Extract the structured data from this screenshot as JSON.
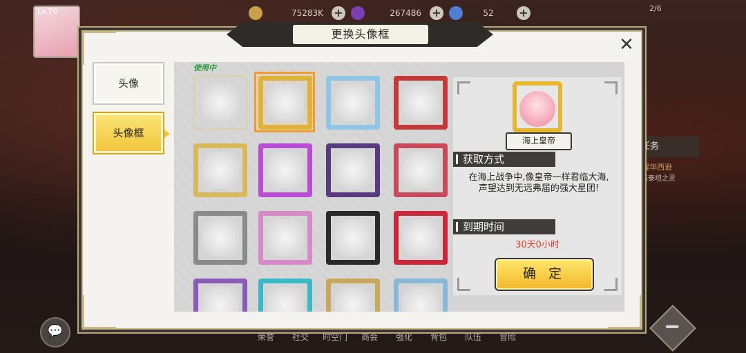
{
  "topbar": {
    "level": "Lv.70",
    "gold": "75283K",
    "gems": "267486",
    "energy": "52",
    "corner_value": "2/6",
    "gold_color": "#c9a14a",
    "gem_color": "#7b3fb0",
    "energy_color": "#4e7fd0"
  },
  "dialog": {
    "title": "更换头像框",
    "close_icon": "close-icon",
    "tabs": [
      {
        "label": "头像",
        "selected": false
      },
      {
        "label": "头像框",
        "selected": true
      }
    ],
    "in_use_label": "使用中",
    "frames": [
      {
        "id": "f01",
        "color": "#d9cfa8"
      },
      {
        "id": "f02",
        "color": "#e0b23a"
      },
      {
        "id": "f03",
        "color": "#8fc6e6"
      },
      {
        "id": "f04",
        "color": "#c23a3a"
      },
      {
        "id": "f05",
        "color": "#d8b95a"
      },
      {
        "id": "f06",
        "color": "#b94bd4"
      },
      {
        "id": "f07",
        "color": "#5a3a7e"
      },
      {
        "id": "f08",
        "color": "#c84a5a"
      },
      {
        "id": "f09",
        "color": "#8a8a8a"
      },
      {
        "id": "f10",
        "color": "#d889c8"
      },
      {
        "id": "f11",
        "color": "#2a2a2a"
      },
      {
        "id": "f12",
        "color": "#c8283a"
      },
      {
        "id": "f13",
        "color": "#8a5ab8"
      },
      {
        "id": "f14",
        "color": "#3ab8c8"
      },
      {
        "id": "f15",
        "color": "#c8a85a"
      },
      {
        "id": "f16",
        "color": "#88b8d8"
      }
    ],
    "detail": {
      "frame_name": "海上皇帝",
      "acquire_heading": "获取方式",
      "acquire_desc": "在海上战争中,像皇帝一样君临大海,声望达到无远弗届的强大星团!",
      "expire_heading": "到期时间",
      "expire_value": "30天0小时",
      "confirm_label": "确 定"
    }
  },
  "side": {
    "quest_label": "任务",
    "quest_sub": "恶醒华西逊",
    "quest_sub2": "噗恶泰坦之灵"
  },
  "bottom_nav": [
    "荣誉",
    "社交",
    "时空门",
    "商会",
    "强化",
    "背包",
    "队伍",
    "冒险"
  ]
}
